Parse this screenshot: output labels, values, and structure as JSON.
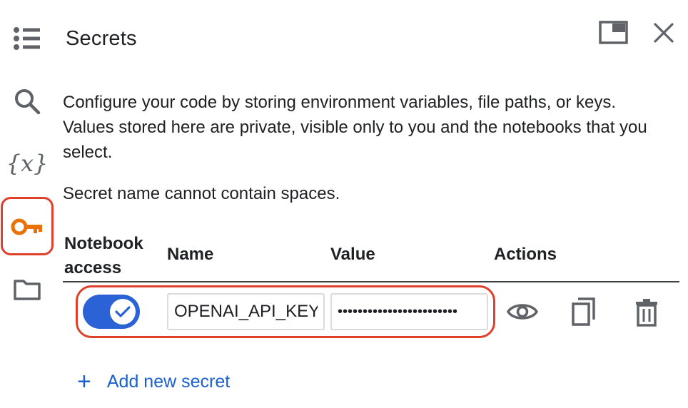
{
  "panel": {
    "title": "Secrets",
    "description": "Configure your code by storing environment variables, file paths, or keys. Values stored here are private, visible only to you and the notebooks that you select.",
    "note": "Secret name cannot contain spaces."
  },
  "rail": {
    "icons": [
      "table-of-contents-icon",
      "search-icon",
      "variables-icon",
      "key-icon",
      "folder-icon"
    ],
    "active": "key-icon",
    "variables_glyph": "{x}"
  },
  "header_actions": {
    "icons": [
      "open-in-tab-icon",
      "close-icon"
    ]
  },
  "table": {
    "headers": {
      "access_line1": "Notebook",
      "access_line2": "access",
      "name": "Name",
      "value": "Value",
      "actions": "Actions"
    },
    "rows": [
      {
        "access_enabled": true,
        "name": "OPENAI_API_KEY",
        "value": "••••••••••••••••••••••••",
        "actions": [
          "show-value-icon",
          "copy-icon",
          "delete-icon"
        ]
      }
    ]
  },
  "add_secret": {
    "icon": "plus-icon",
    "label": "Add new secret"
  },
  "colors": {
    "accent": "#1a5fce",
    "toggle": "#2b62d6",
    "highlight": "#e0402b",
    "key_icon": "#e8710a",
    "icon_gray": "#5f6368"
  }
}
